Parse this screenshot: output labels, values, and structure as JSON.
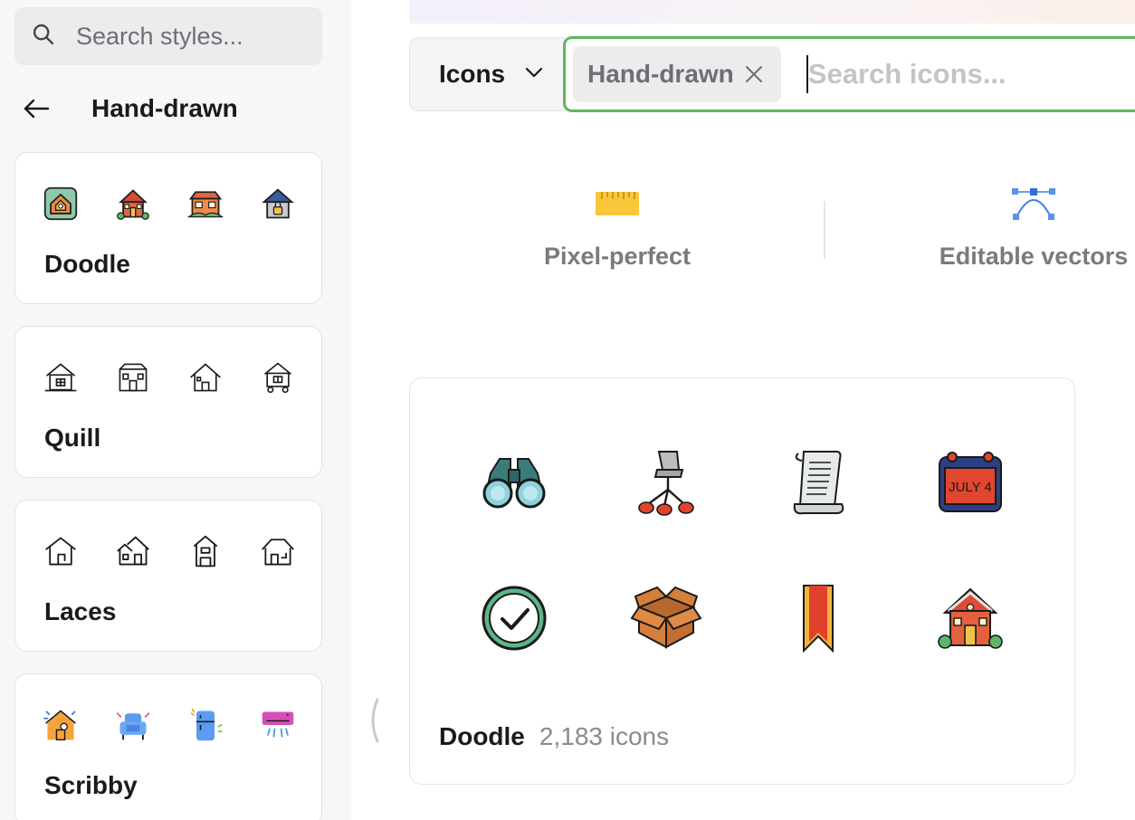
{
  "sidebar": {
    "search": {
      "placeholder": "Search styles..."
    },
    "back_title": "Hand-drawn",
    "styles": [
      {
        "name": "Doodle"
      },
      {
        "name": "Quill"
      },
      {
        "name": "Laces"
      },
      {
        "name": "Scribby"
      }
    ]
  },
  "toolbar": {
    "type_label": "Icons",
    "chip_label": "Hand-drawn",
    "search_placeholder": "Search icons..."
  },
  "features": [
    {
      "label": "Pixel-perfect",
      "icon": "ruler-icon"
    },
    {
      "label": "Editable vectors",
      "icon": "vector-nodes-icon"
    }
  ],
  "result": {
    "name": "Doodle",
    "count": "2,183 icons",
    "icons": [
      "binoculars",
      "office-chair",
      "scroll",
      "calendar-july-4",
      "check-circle",
      "open-box",
      "bookmark-ribbon",
      "house"
    ],
    "calendar_text": "JULY 4"
  },
  "colors": {
    "accent_border": "#5cb85c",
    "sidebar_bg": "#f7f7f8"
  }
}
